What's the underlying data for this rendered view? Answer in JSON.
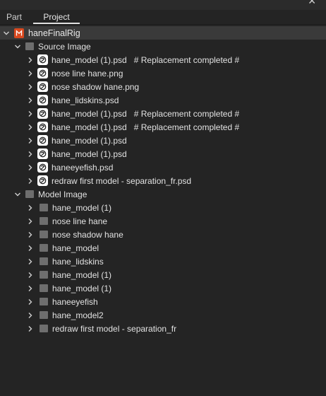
{
  "tabs": {
    "part": "Part",
    "project": "Project"
  },
  "root": {
    "label": "haneFinalRig"
  },
  "source_group": {
    "label": "Source Image"
  },
  "model_group": {
    "label": "Model Image"
  },
  "source_items": [
    {
      "label": "hane_model (1).psd",
      "note": "# Replacement completed #"
    },
    {
      "label": "nose line hane.png",
      "note": ""
    },
    {
      "label": "nose shadow hane.png",
      "note": ""
    },
    {
      "label": "hane_lidskins.psd",
      "note": ""
    },
    {
      "label": "hane_model (1).psd",
      "note": "# Replacement completed #"
    },
    {
      "label": "hane_model (1).psd",
      "note": "# Replacement completed #"
    },
    {
      "label": "hane_model (1).psd",
      "note": ""
    },
    {
      "label": "hane_model (1).psd",
      "note": ""
    },
    {
      "label": "haneeyefish.psd",
      "note": ""
    },
    {
      "label": "redraw first model - separation_fr.psd",
      "note": ""
    }
  ],
  "model_items": [
    {
      "label": "hane_model (1)"
    },
    {
      "label": "nose line hane"
    },
    {
      "label": "nose shadow hane"
    },
    {
      "label": "hane_model"
    },
    {
      "label": "hane_lidskins"
    },
    {
      "label": "hane_model (1)"
    },
    {
      "label": "hane_model (1)"
    },
    {
      "label": "haneeyefish"
    },
    {
      "label": "hane_model2"
    },
    {
      "label": "redraw first model - separation_fr"
    }
  ]
}
